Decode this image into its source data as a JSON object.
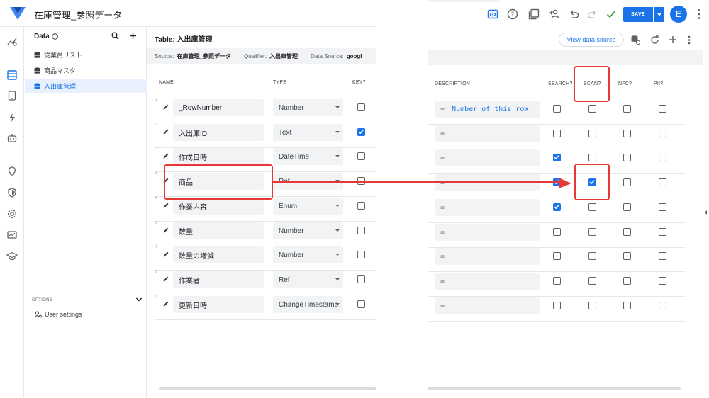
{
  "app": {
    "title": "在庫管理_参照データ"
  },
  "toolbar": {
    "save_label": "SAVE",
    "avatar_initial": "E"
  },
  "data_panel": {
    "heading": "Data",
    "tables": [
      {
        "label": "従業員リスト",
        "active": false
      },
      {
        "label": "商品マスタ",
        "active": false
      },
      {
        "label": "入出庫管理",
        "active": true
      }
    ],
    "options_label": "OPTIONS",
    "user_settings_label": "User settings"
  },
  "table": {
    "title": "Table: 入出庫管理",
    "source_label": "Source:",
    "source_value": "在庫管理_参照データ",
    "qualifier_label": "Qualifier:",
    "qualifier_value": "入出庫管理",
    "data_source_label": "Data Source:",
    "data_source_value": "googl",
    "view_data_source": "View data source"
  },
  "columns": {
    "name": "NAME",
    "type": "TYPE",
    "key": "KEY?",
    "description": "DESCRIPTION",
    "search": "SEARCH?",
    "scan": "SCAN?",
    "nfc": "NFC?",
    "pii": "PII?"
  },
  "rows": [
    {
      "num": "1",
      "name": "_RowNumber",
      "type": "Number",
      "key": false,
      "desc_eq": "=",
      "desc": "Number of this row",
      "search": false,
      "scan": false,
      "nfc": false,
      "pii": false
    },
    {
      "num": "2",
      "name": "入出庫ID",
      "type": "Text",
      "key": true,
      "desc_eq": "=",
      "desc": "",
      "search": false,
      "scan": false,
      "nfc": false,
      "pii": false
    },
    {
      "num": "3",
      "name": "作成日時",
      "type": "DateTime",
      "key": false,
      "desc_eq": "=",
      "desc": "",
      "search": true,
      "scan": false,
      "nfc": false,
      "pii": false
    },
    {
      "num": "4",
      "name": "商品",
      "type": "Ref",
      "key": false,
      "desc_eq": "=",
      "desc": "",
      "search": true,
      "scan": true,
      "nfc": false,
      "pii": false
    },
    {
      "num": "5",
      "name": "作業内容",
      "type": "Enum",
      "key": false,
      "desc_eq": "=",
      "desc": "",
      "search": true,
      "scan": false,
      "nfc": false,
      "pii": false
    },
    {
      "num": "6",
      "name": "数量",
      "type": "Number",
      "key": false,
      "desc_eq": "=",
      "desc": "",
      "search": false,
      "scan": false,
      "nfc": false,
      "pii": false
    },
    {
      "num": "7",
      "name": "数量の増減",
      "type": "Number",
      "key": false,
      "desc_eq": "=",
      "desc": "",
      "search": false,
      "scan": false,
      "nfc": false,
      "pii": false
    },
    {
      "num": "8",
      "name": "作業者",
      "type": "Ref",
      "key": false,
      "desc_eq": "=",
      "desc": "",
      "search": false,
      "scan": false,
      "nfc": false,
      "pii": false
    },
    {
      "num": "9",
      "name": "更新日時",
      "type": "ChangeTimestamp",
      "key": false,
      "desc_eq": "=",
      "desc": "",
      "search": false,
      "scan": false,
      "nfc": false,
      "pii": false
    }
  ],
  "colors": {
    "accent": "#1a73e8",
    "annotation": "#e53935"
  },
  "icons": [
    "preview-icon",
    "help-icon",
    "copy-icon",
    "share-icon",
    "undo-icon",
    "redo-icon",
    "check-icon",
    "more-vert-icon"
  ]
}
